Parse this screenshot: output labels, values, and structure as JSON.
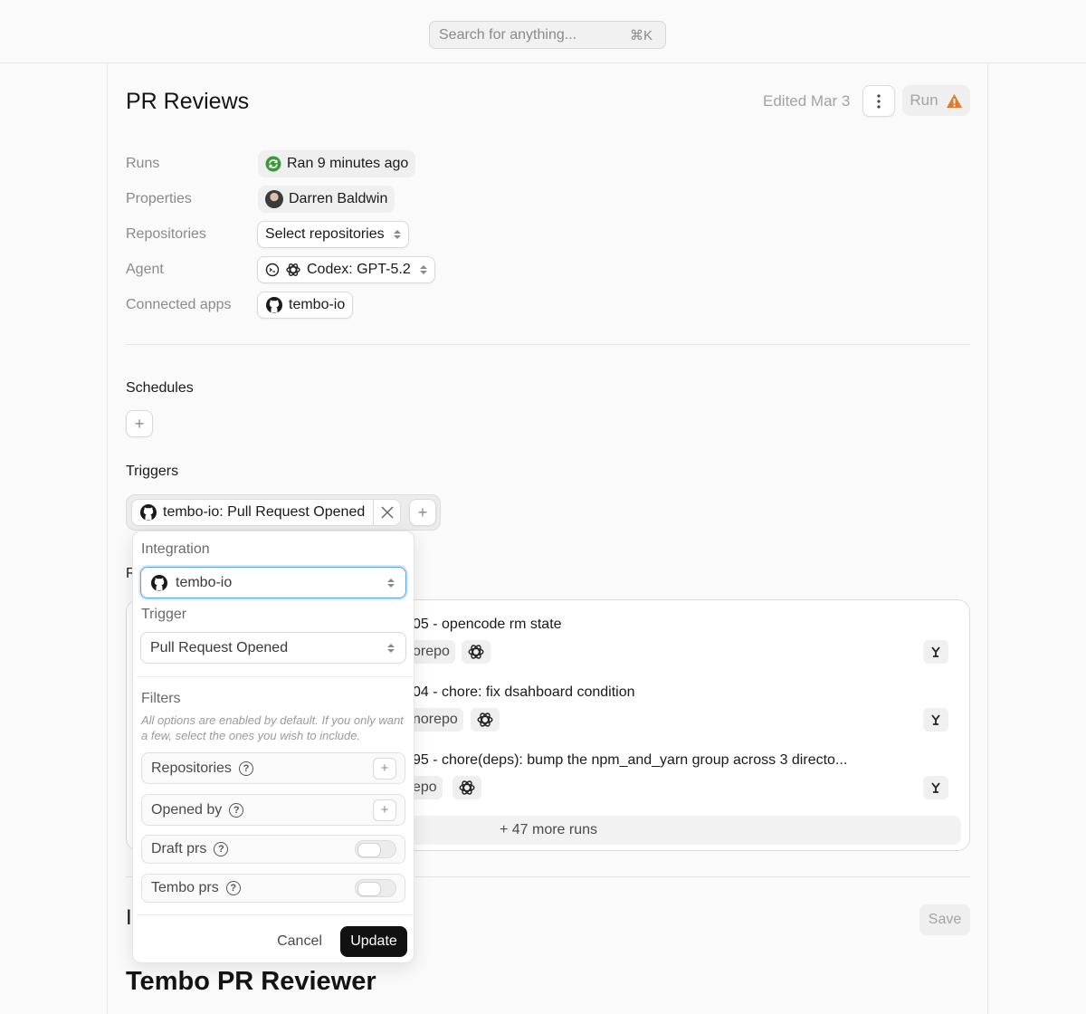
{
  "search": {
    "placeholder": "Search for anything...",
    "shortcut": "⌘K"
  },
  "page": {
    "title": "PR Reviews",
    "edited": "Edited Mar 3",
    "run_label": "Run"
  },
  "properties": [
    {
      "label": "Runs",
      "value": "Ran 9 minutes ago"
    },
    {
      "label": "Properties",
      "value": "Darren Baldwin"
    },
    {
      "label": "Repositories",
      "value": "Select repositories"
    },
    {
      "label": "Agent",
      "value": "Codex: GPT-5.2"
    },
    {
      "label": "Connected apps",
      "value": "tembo-io"
    }
  ],
  "schedules": {
    "title": "Schedules",
    "add_label": "+"
  },
  "triggers": {
    "title": "Triggers",
    "chip_label": "tembo-io: Pull Request Opened",
    "add_label": "+"
  },
  "runs": {
    "section_partial": "R",
    "items": [
      {
        "title": "05 - opencode rm state",
        "repo": "orepo"
      },
      {
        "title": "04 - chore: fix dsahboard condition",
        "repo": "norepo"
      },
      {
        "title": "95 - chore(deps): bump the npm_and_yarn group across 3 directo...",
        "repo": "epo"
      }
    ],
    "more": "+ 47 more runs"
  },
  "instructions": {
    "section_partial": "I",
    "save_label": "Save",
    "heading": "Tembo PR Reviewer"
  },
  "popover": {
    "integration_label": "Integration",
    "integration_value": "tembo-io",
    "trigger_label": "Trigger",
    "trigger_value": "Pull Request Opened",
    "filters_label": "Filters",
    "filters_hint": "All options are enabled by default. If you only want a few, select the ones you wish to include.",
    "filters": [
      {
        "name": "Repositories",
        "control": "plus"
      },
      {
        "name": "Opened by",
        "control": "plus"
      },
      {
        "name": "Draft prs",
        "control": "toggle"
      },
      {
        "name": "Tembo prs",
        "control": "toggle"
      }
    ],
    "cancel_label": "Cancel",
    "update_label": "Update"
  },
  "colors": {
    "accent_focus": "#5ba3e0",
    "status_green": "#3a9a3a",
    "warning_orange": "#e07a2e"
  }
}
